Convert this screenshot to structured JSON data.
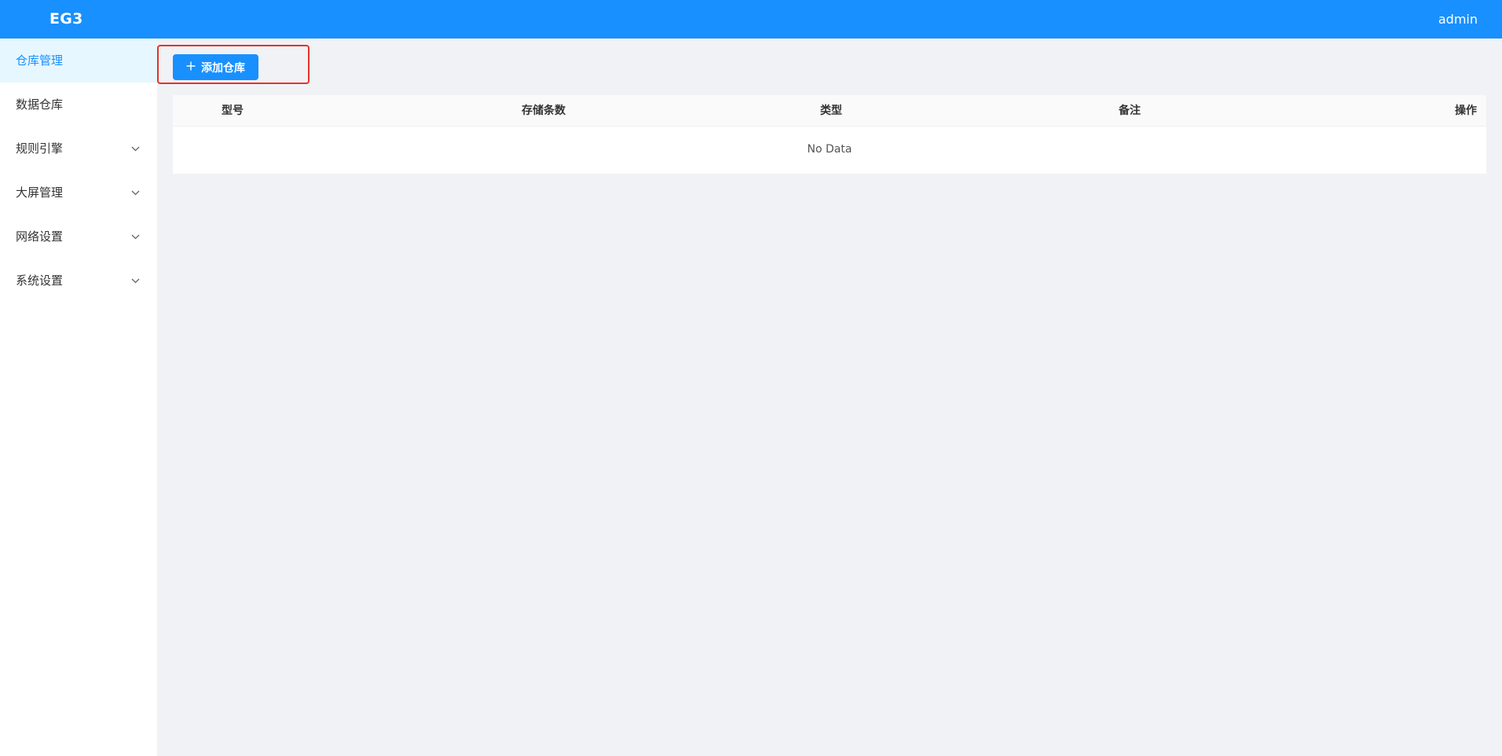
{
  "header": {
    "brand": "EG3",
    "user": "admin"
  },
  "sidebar": {
    "items": [
      {
        "label": "仓库管理",
        "active": true,
        "expandable": false
      },
      {
        "label": "数据仓库",
        "active": false,
        "expandable": false
      },
      {
        "label": "规则引擎",
        "active": false,
        "expandable": true
      },
      {
        "label": "大屏管理",
        "active": false,
        "expandable": true
      },
      {
        "label": "网络设置",
        "active": false,
        "expandable": true
      },
      {
        "label": "系统设置",
        "active": false,
        "expandable": true
      }
    ]
  },
  "toolbar": {
    "add_label": "添加仓库"
  },
  "table": {
    "columns": [
      "型号",
      "存储条数",
      "类型",
      "备注",
      "操作"
    ],
    "rows": [],
    "empty_text": "No Data"
  },
  "colors": {
    "primary": "#1890ff",
    "highlight_border": "#e8302c",
    "active_bg": "#e6f7ff",
    "page_bg": "#f0f2f5"
  }
}
